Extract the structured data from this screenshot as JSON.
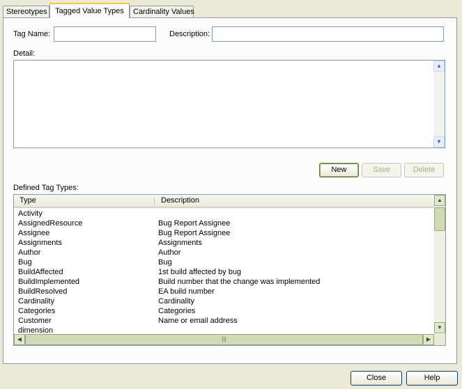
{
  "tabs": [
    {
      "label": "Stereotypes"
    },
    {
      "label": "Tagged Value Types"
    },
    {
      "label": "Cardinality Values"
    }
  ],
  "form": {
    "tag_name_label": "Tag Name:",
    "tag_name_value": "",
    "description_label": "Description:",
    "description_value": "",
    "detail_label": "Detail:"
  },
  "actions": {
    "new": "New",
    "save": "Save",
    "delete": "Delete"
  },
  "list": {
    "label": "Defined Tag Types:",
    "columns": [
      "Type",
      "Description"
    ],
    "rows": [
      {
        "type": "Activity",
        "description": ""
      },
      {
        "type": "AssignedResource",
        "description": "Bug Report Assignee"
      },
      {
        "type": "Assignee",
        "description": "Bug Report Assignee"
      },
      {
        "type": "Assignments",
        "description": "Assignments"
      },
      {
        "type": "Author",
        "description": "Author"
      },
      {
        "type": "Bug",
        "description": "Bug"
      },
      {
        "type": "BuildAffected",
        "description": "1st build affected by bug"
      },
      {
        "type": "BuildImplemented",
        "description": "Build number that the change was implemented"
      },
      {
        "type": "BuildResolved",
        "description": "EA build number"
      },
      {
        "type": "Cardinality",
        "description": "Cardinality"
      },
      {
        "type": "Categories",
        "description": "Categories"
      },
      {
        "type": "Customer",
        "description": "Name or email address"
      },
      {
        "type": "dimension",
        "description": ""
      }
    ]
  },
  "footer": {
    "close": "Close",
    "help": "Help"
  }
}
